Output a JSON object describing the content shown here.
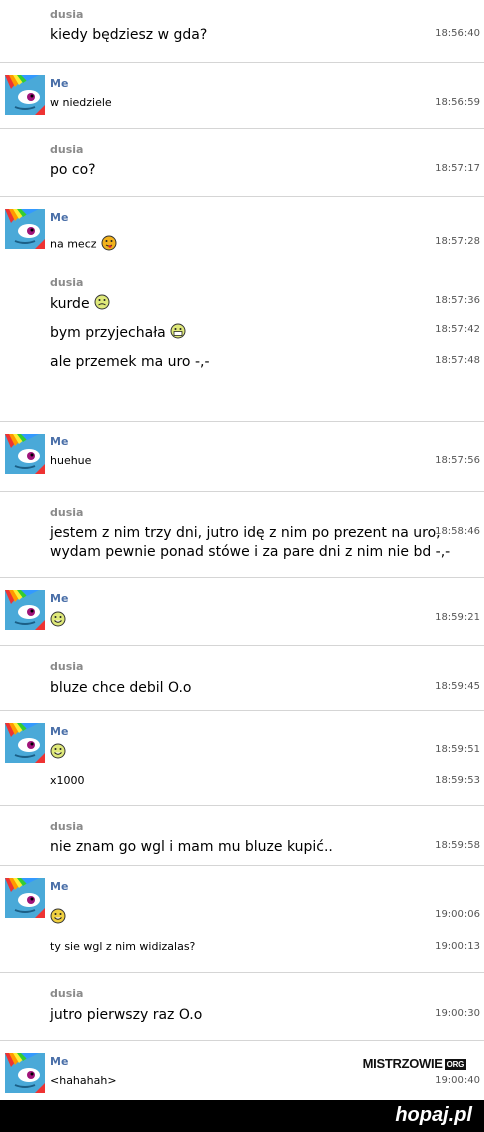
{
  "messages": [
    {
      "sender": "dusia",
      "lines": [
        {
          "text": "kiedy będziesz w gda?",
          "time": "18:56:40"
        }
      ]
    },
    {
      "sender": "Me",
      "lines": [
        {
          "text": "w niedziele",
          "time": "18:56:59"
        }
      ]
    },
    {
      "sender": "dusia",
      "lines": [
        {
          "text": "po co?",
          "time": "18:57:17"
        }
      ]
    },
    {
      "sender": "Me",
      "lines": [
        {
          "text": "na mecz",
          "time": "18:57:28",
          "emoticon": "tongue-emoticon-icon"
        }
      ]
    },
    {
      "sender": "dusia",
      "lines": [
        {
          "text": "kurde",
          "time": "18:57:36",
          "emoticon": "grimace-emoticon-icon"
        },
        {
          "text": "bym przyjechała",
          "time": "18:57:42",
          "emoticon": "grin-emoticon-icon"
        },
        {
          "text": "ale przemek ma uro -,-",
          "time": "18:57:48"
        }
      ]
    },
    {
      "sender": "Me",
      "lines": [
        {
          "text": "huehue",
          "time": "18:57:56"
        }
      ]
    },
    {
      "sender": "dusia",
      "lines": [
        {
          "text": "jestem z nim trzy dni, jutro idę z nim po prezent na uro,",
          "time": "18:58:46"
        },
        {
          "text": "wydam pewnie ponad stówe i za pare dni z nim nie bd -,-",
          "time": ""
        }
      ]
    },
    {
      "sender": "Me",
      "lines": [
        {
          "text": "",
          "time": "18:59:21",
          "emoticon": "laugh-emoticon-icon"
        }
      ]
    },
    {
      "sender": "dusia",
      "lines": [
        {
          "text": "bluze chce debil O.o",
          "time": "18:59:45"
        }
      ]
    },
    {
      "sender": "Me",
      "lines": [
        {
          "text": "",
          "time": "18:59:51",
          "emoticon": "laugh-emoticon-icon"
        },
        {
          "text": "x1000",
          "time": "18:59:53"
        }
      ]
    },
    {
      "sender": "dusia",
      "lines": [
        {
          "text": "nie znam go wgl i mam mu bluze kupić..",
          "time": "18:59:58"
        }
      ]
    },
    {
      "sender": "Me",
      "lines": [
        {
          "text": "",
          "time": "19:00:06",
          "emoticon": "smile-emoticon-icon"
        },
        {
          "text": "ty sie wgl z nim widizalas?",
          "time": "19:00:13"
        }
      ]
    },
    {
      "sender": "dusia",
      "lines": [
        {
          "text": "jutro pierwszy raz O.o",
          "time": "19:00:30"
        }
      ]
    },
    {
      "sender": "Me",
      "lines": [
        {
          "text": "<hahahah>",
          "time": "19:00:40"
        }
      ]
    }
  ],
  "watermark": {
    "main": "MISTRZOWIE",
    "suffix": "ORG"
  },
  "footer": {
    "brand": "hopaj.pl"
  },
  "colors": {
    "avatar_bg": "#4aa9d8",
    "me_name": "#4a6fa8",
    "dusia_name": "#8a8a8a",
    "separator": "#d5d5d5"
  }
}
